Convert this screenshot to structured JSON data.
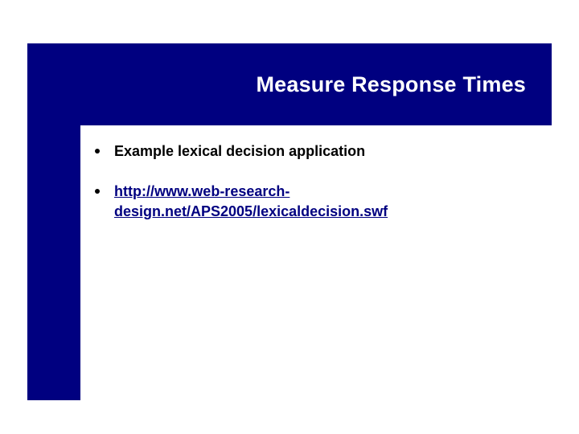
{
  "title": "Measure Response Times",
  "bullets": [
    {
      "type": "text",
      "text": "Example lexical decision application"
    },
    {
      "type": "link",
      "line1": "http://www.web-research-",
      "line2": "design.net/APS2005/lexicaldecision.swf"
    }
  ]
}
